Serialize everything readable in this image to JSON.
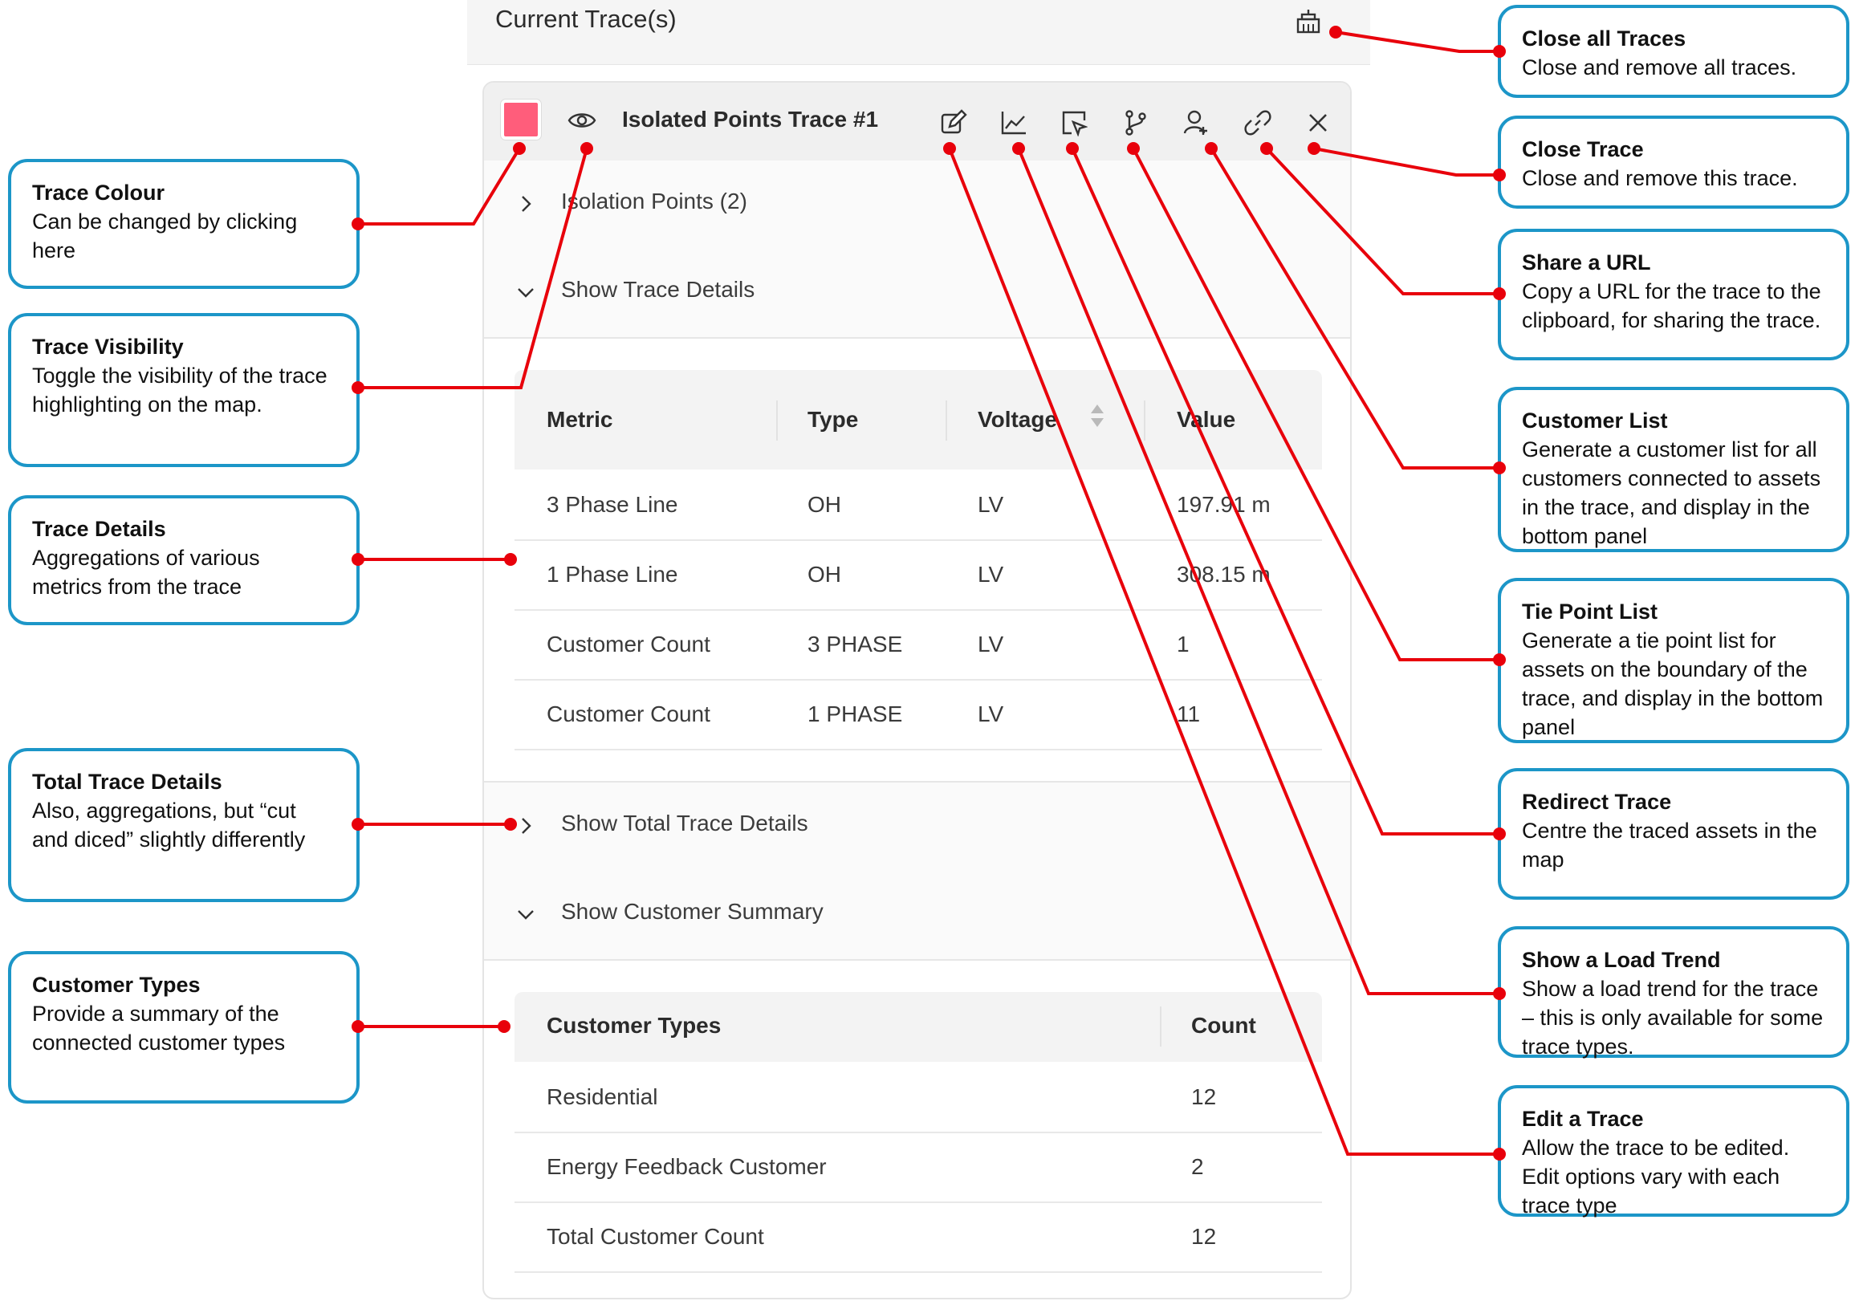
{
  "panel": {
    "title": "Current Trace(s)",
    "trace_name": "Isolated Points Trace #1",
    "trace_colour": "#ff5d7b",
    "header_icons": [
      "clear-all-icon"
    ],
    "toolbar_icons": [
      "edit-icon",
      "load-trend-icon",
      "redirect-icon",
      "tie-point-icon",
      "customer-list-icon",
      "link-icon",
      "close-icon"
    ],
    "isolation_points_label": "Isolation Points (2)",
    "trace_details_label": "Show Trace Details",
    "total_trace_details_label": "Show Total Trace Details",
    "customer_summary_label": "Show Customer Summary"
  },
  "metrics_table": {
    "headers": [
      "Metric",
      "Type",
      "Voltage",
      "Value"
    ],
    "rows": [
      [
        "3 Phase Line",
        "OH",
        "LV",
        "197.91 m"
      ],
      [
        "1 Phase Line",
        "OH",
        "LV",
        "308.15 m"
      ],
      [
        "Customer Count",
        "3 PHASE",
        "LV",
        "1"
      ],
      [
        "Customer Count",
        "1 PHASE",
        "LV",
        "11"
      ]
    ]
  },
  "customer_table": {
    "headers": [
      "Customer Types",
      "Count"
    ],
    "rows": [
      [
        "Residential",
        "12"
      ],
      [
        "Energy Feedback Customer",
        "2"
      ],
      [
        "Total Customer Count",
        "12"
      ]
    ]
  },
  "annotations": {
    "trace_colour": {
      "title": "Trace Colour",
      "desc": "Can be changed by clicking here"
    },
    "trace_visibility": {
      "title": "Trace Visibility",
      "desc": "Toggle the visibility of the trace highlighting on the map."
    },
    "trace_details": {
      "title": "Trace Details",
      "desc": "Aggregations of various metrics from the trace"
    },
    "total_trace_details": {
      "title": "Total Trace Details",
      "desc": "Also, aggregations, but “cut and diced” slightly differently"
    },
    "customer_types": {
      "title": "Customer Types",
      "desc": "Provide a summary of the connected customer types"
    },
    "close_all": {
      "title": "Close all Traces",
      "desc": "Close and remove all traces."
    },
    "close_trace": {
      "title": "Close Trace",
      "desc": "Close and remove this trace."
    },
    "share_url": {
      "title": "Share a URL",
      "desc": "Copy a URL for the trace to the clipboard, for sharing the trace."
    },
    "customer_list": {
      "title": "Customer List",
      "desc": "Generate a customer list for all customers connected to assets in the trace, and display in the bottom panel"
    },
    "tie_point_list": {
      "title": "Tie Point List",
      "desc": "Generate a tie point list for assets on the boundary of the trace, and display in the bottom panel"
    },
    "redirect_trace": {
      "title": "Redirect Trace",
      "desc": "Centre the traced assets in the map"
    },
    "load_trend": {
      "title": "Show a Load Trend",
      "desc": "Show a load trend for the trace – this is only available for some trace types."
    },
    "edit_trace": {
      "title": "Edit  a Trace",
      "desc": "Allow the trace to be edited. Edit options vary with each trace type"
    }
  },
  "colors": {
    "annotation_border": "#1c96c8",
    "leader_line": "#e8000b",
    "panel_bg": "#f5f5f5"
  }
}
